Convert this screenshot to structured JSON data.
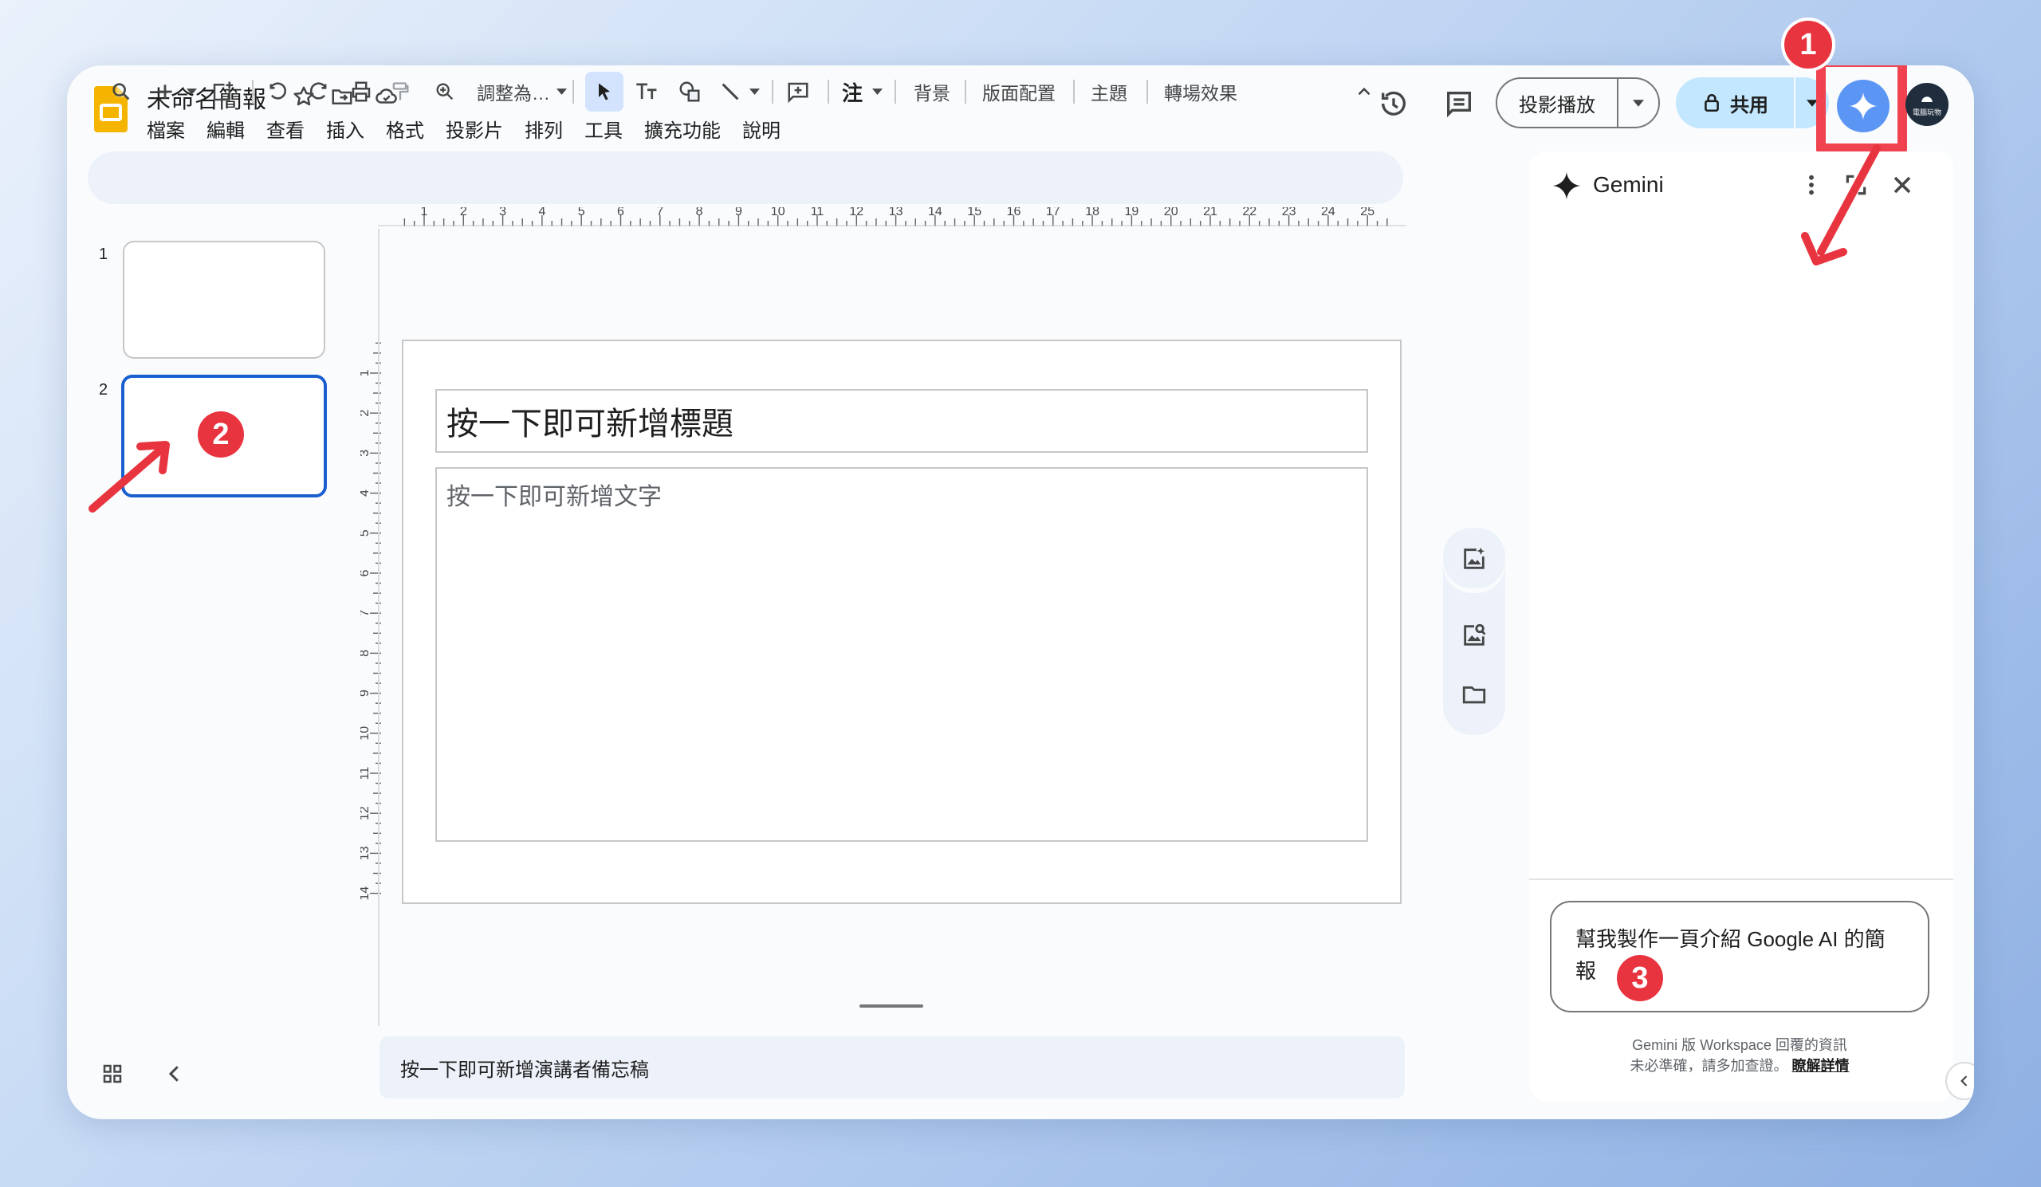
{
  "doc": {
    "title": "未命名簡報"
  },
  "menu": [
    "檔案",
    "編輯",
    "查看",
    "插入",
    "格式",
    "投影片",
    "排列",
    "工具",
    "擴充功能",
    "說明"
  ],
  "header": {
    "present_label": "投影播放",
    "share_label": "共用",
    "avatar_text": "電腦玩物"
  },
  "toolbar": {
    "zoom_label": "調整為…",
    "annotate_label": "注",
    "background_label": "背景",
    "layout_label": "版面配置",
    "theme_label": "主題",
    "transition_label": "轉場效果"
  },
  "slides": [
    {
      "number": "1"
    },
    {
      "number": "2"
    }
  ],
  "ruler": {
    "h": [
      "1",
      "2",
      "3",
      "4",
      "5",
      "6",
      "7",
      "8",
      "9",
      "10",
      "11",
      "12",
      "13",
      "14",
      "15",
      "16",
      "17",
      "18",
      "19",
      "20",
      "21",
      "22",
      "23",
      "24",
      "25"
    ],
    "v": [
      "1",
      "2",
      "3",
      "4",
      "5",
      "6",
      "7",
      "8",
      "9",
      "10",
      "11",
      "12",
      "13",
      "14"
    ]
  },
  "canvas": {
    "title_placeholder": "按一下即可新增標題",
    "body_placeholder": "按一下即可新增文字"
  },
  "notes": {
    "placeholder": "按一下即可新增演講者備忘稿"
  },
  "gemini": {
    "title": "Gemini",
    "prompt_text": "幫我製作一頁介紹 Google AI 的簡報",
    "disclaimer_line1": "Gemini 版 Workspace 回覆的資訊",
    "disclaimer_line2": "未必準確，請多加查證。",
    "learn_more": "瞭解詳情"
  },
  "annotations": {
    "badge1": "1",
    "badge2": "2",
    "badge3": "3",
    "color": "#e8343f"
  },
  "colors": {
    "accent": "#1a5fd0",
    "gemini_button": "#5c96f5",
    "share_button": "#c2e7ff"
  }
}
